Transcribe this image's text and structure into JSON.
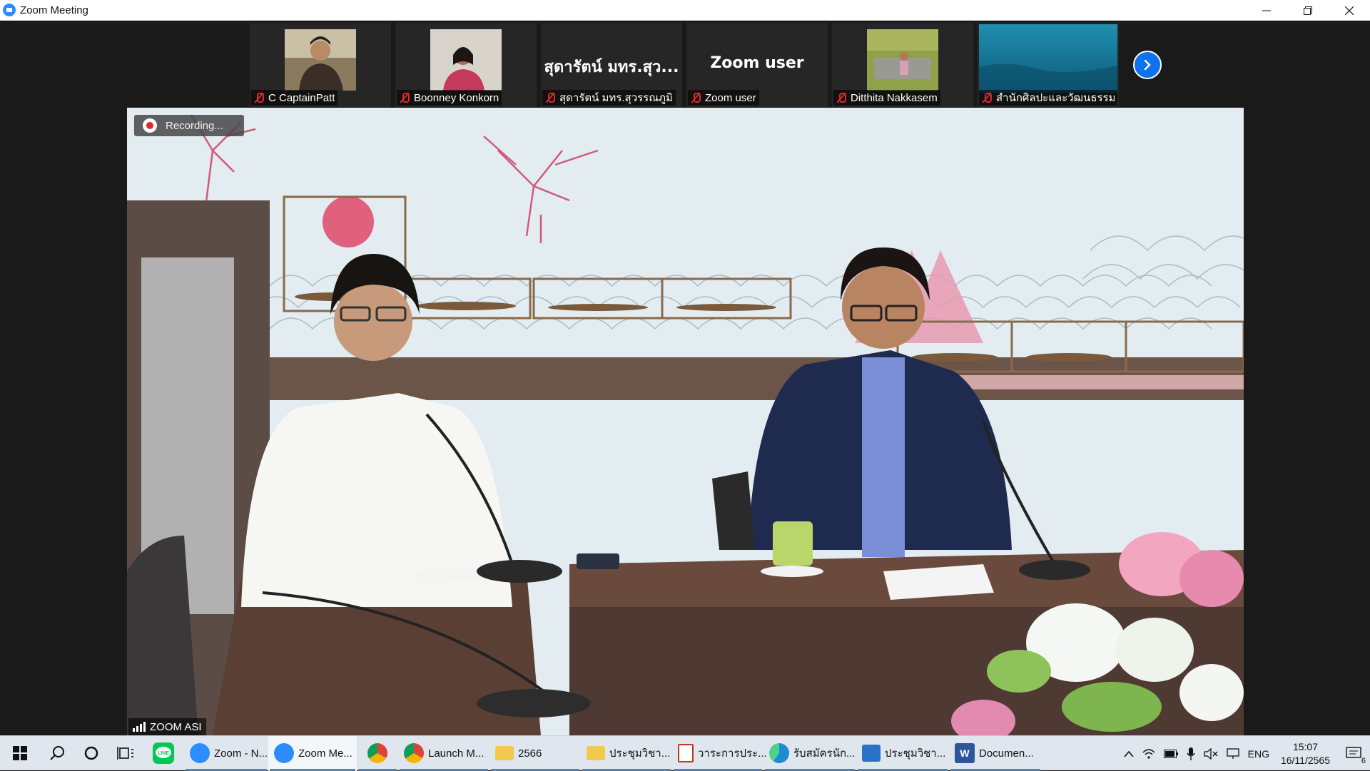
{
  "window": {
    "title": "Zoom Meeting",
    "controls": [
      "minimize",
      "restore",
      "close"
    ]
  },
  "participants": [
    {
      "name": "C CaptainPatt",
      "muted": true,
      "has_video": true
    },
    {
      "name": "Boonney Konkorn",
      "muted": true,
      "has_video": true
    },
    {
      "name": "สุดารัตน์ มทร.สุวรรณภูมิ",
      "display_name": "สุดารัตน์ มทร.สุว...",
      "muted": true,
      "has_video": false
    },
    {
      "name": "Zoom user",
      "display_name": "Zoom user",
      "muted": true,
      "has_video": false
    },
    {
      "name": "Ditthita Nakkasem",
      "muted": true,
      "has_video": true
    },
    {
      "name": "สำนักศิลปะและวัฒนธรรม ...",
      "muted": true,
      "has_video": true
    }
  ],
  "main_video": {
    "recording_label": "Recording...",
    "speaker_label": "ZOOM ASI"
  },
  "taskbar": {
    "apps": [
      {
        "label": "Zoom - N...",
        "icon": "zoom-icon",
        "color": "#2d8cff",
        "open": true,
        "active": false
      },
      {
        "label": "Zoom Me...",
        "icon": "zoom-icon",
        "color": "#2d8cff",
        "open": true,
        "active": true
      },
      {
        "label": "",
        "icon": "chrome-icon",
        "color": "#db4437",
        "open": true,
        "active": false
      },
      {
        "label": "Launch M...",
        "icon": "chrome-icon",
        "color": "#db4437",
        "open": true,
        "active": false
      },
      {
        "label": "2566",
        "icon": "folder-icon",
        "color": "#f2c94c",
        "open": true,
        "active": false
      },
      {
        "label": "ประชุมวิชา...",
        "icon": "folder-icon",
        "color": "#f2c94c",
        "open": true,
        "active": false
      },
      {
        "label": "วาระการประ...",
        "icon": "pdf-icon",
        "color": "#c0392b",
        "open": true,
        "active": false
      },
      {
        "label": "รับสมัครนัก...",
        "icon": "edge-icon",
        "color": "#1f8ad6",
        "open": true,
        "active": false
      },
      {
        "label": "ประชุมวิชา...",
        "icon": "photos-icon",
        "color": "#2a72c6",
        "open": true,
        "active": false
      },
      {
        "label": "Documen...",
        "icon": "word-icon",
        "color": "#2b579a",
        "open": true,
        "active": false
      }
    ],
    "language": "ENG",
    "time": "15:07",
    "date": "16/11/2565",
    "notifications": "6"
  }
}
